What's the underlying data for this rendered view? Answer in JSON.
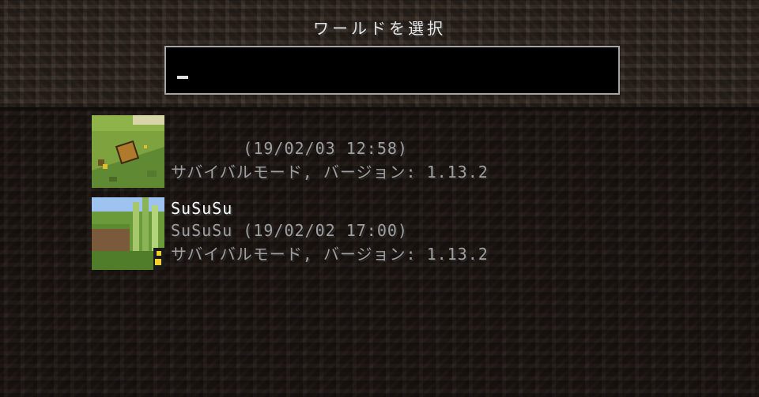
{
  "screen": {
    "title": "ワールドを選択"
  },
  "search": {
    "value": "",
    "placeholder": ""
  },
  "worlds": [
    {
      "name": "",
      "detail": "       (19/02/03 12:58)",
      "mode_version": "サバイバルモード, バージョン: 1.13.2"
    },
    {
      "name": "SuSuSu",
      "detail": "SuSuSu (19/02/02 17:00)",
      "mode_version": "サバイバルモード, バージョン: 1.13.2"
    }
  ],
  "colors": {
    "header_bg": "#2e2620",
    "list_bg": "#1d1612",
    "search_border": "#a5a5a5",
    "text_primary": "#ffffff",
    "text_secondary": "#a0a0a0"
  }
}
